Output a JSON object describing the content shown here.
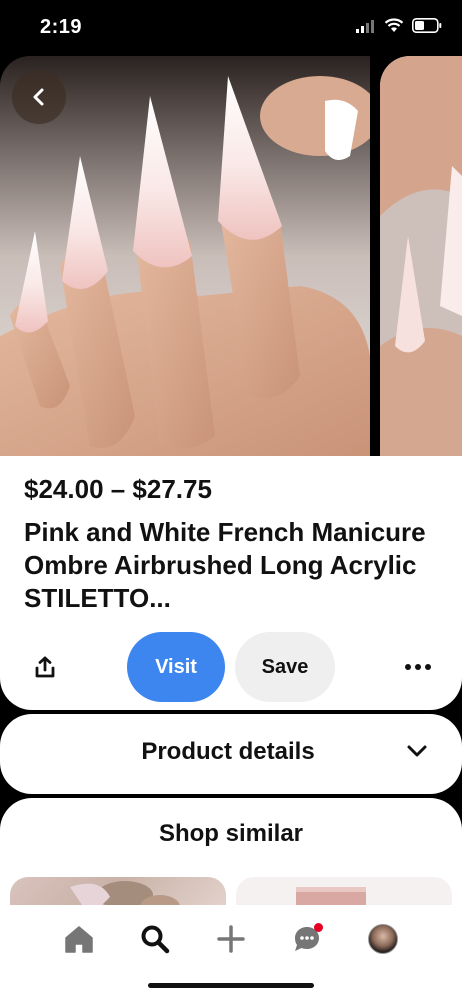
{
  "status_bar": {
    "time": "2:19"
  },
  "pin": {
    "price": "$24.00 – $27.75",
    "title": "Pink and White French Manicure Ombre Airbrushed Long Acrylic STILETTO...",
    "visit_label": "Visit",
    "save_label": "Save"
  },
  "product_details": {
    "label": "Product details"
  },
  "shop_similar": {
    "label": "Shop similar"
  },
  "icons": {
    "back": "chevron-left-icon",
    "share": "share-icon",
    "more": "more-icon",
    "expand": "chevron-down-icon",
    "home": "home-icon",
    "search": "search-icon",
    "create": "plus-icon",
    "messages": "chat-icon",
    "profile": "avatar"
  },
  "colors": {
    "visit_button": "#3d86f0",
    "save_button": "#efefef",
    "notification_dot": "#e60023"
  }
}
